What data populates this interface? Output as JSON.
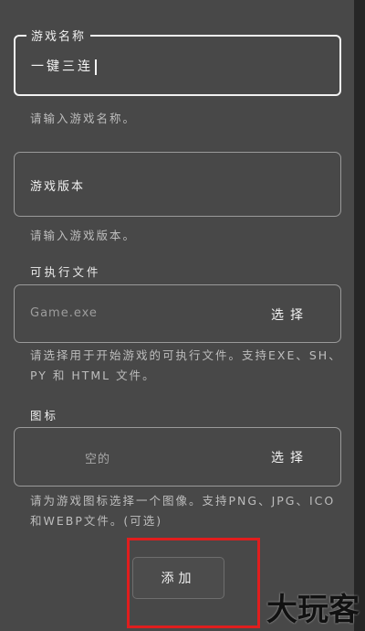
{
  "form": {
    "game_name": {
      "label": "游戏名称",
      "value": "一键三连",
      "helper": "请输入游戏名称。"
    },
    "game_version": {
      "label": "游戏版本",
      "helper": "请输入游戏版本。"
    },
    "executable": {
      "section_label": "可执行文件",
      "placeholder": "Game.exe",
      "select_label": "选择",
      "helper": "请选择用于开始游戏的可执行文件。支持EXE、SH、PY 和 HTML 文件。"
    },
    "icon": {
      "section_label": "图标",
      "placeholder": "空的",
      "select_label": "选择",
      "helper": "请为游戏图标选择一个图像。支持PNG、JPG、ICO和WEBP文件。(可选)"
    },
    "add_button_label": "添加"
  },
  "watermark": {
    "text": "大玩客"
  },
  "colors": {
    "background": "#484848",
    "border_focused": "#f2f2f2",
    "border": "#9a9a9a",
    "highlight": "#e01e1e"
  }
}
